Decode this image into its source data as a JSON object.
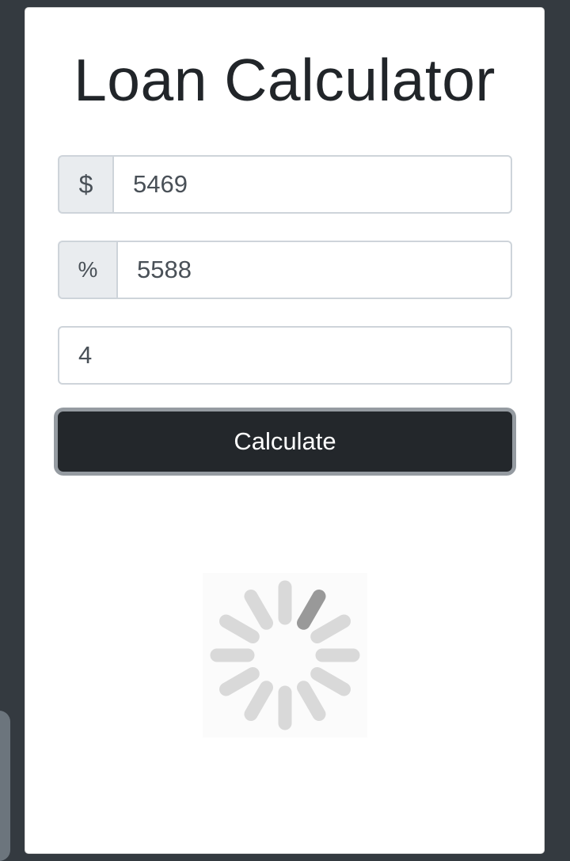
{
  "title": "Loan Calculator",
  "amount": {
    "prefix": "$",
    "value": "5469"
  },
  "interest": {
    "prefix": "%",
    "value": "5588"
  },
  "years": {
    "value": "4"
  },
  "calculate_button": "Calculate",
  "loading": {
    "icon": "loading-spinner-icon",
    "active_segment": 1
  },
  "colors": {
    "background": "#343a40",
    "card": "#ffffff",
    "button": "#23272b",
    "addon": "#e9ecef",
    "spinner_light": "#d9d9d9",
    "spinner_dark": "#999999"
  }
}
